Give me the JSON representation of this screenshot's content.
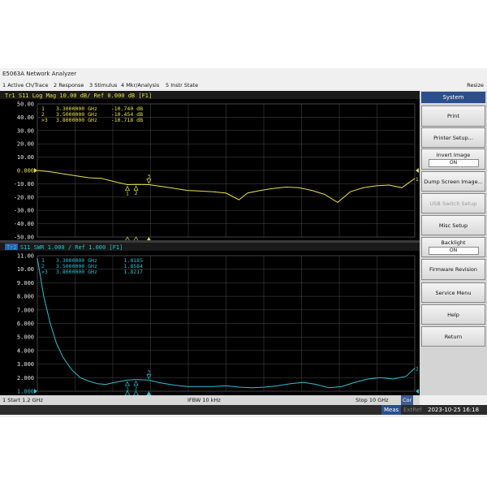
{
  "window": {
    "title": "E5063A Network Analyzer",
    "menu": [
      "1 Active Ch/Trace",
      "2 Response",
      "3 Stimulus",
      "4 Mkr/Analysis",
      "5 Instr State"
    ],
    "resize_label": "Resize"
  },
  "trace1": {
    "header": "Tr1  S11  Log Mag 10.00 dB/ Ref 0.000 dB  [F1]",
    "color": "#e8e23a",
    "markers": [
      {
        "label": "1",
        "freq": "3.3000000 GHz",
        "value": "-10.740 dB"
      },
      {
        "label": "2",
        "freq": "3.5000000 GHz",
        "value": "-10.454 dB"
      },
      {
        "label": ">3",
        "freq": "3.8000000 GHz",
        "value": "-10.718 dB"
      }
    ],
    "yticks": [
      "50.00",
      "40.00",
      "30.00",
      "20.00",
      "10.00",
      "0.000",
      "-10.00",
      "-20.00",
      "-30.00",
      "-40.00",
      "-50.00"
    ],
    "trace_end_label": "1"
  },
  "trace2": {
    "header": "Tr2  S11  SWR 1.000 / Ref 1.000  [F1]",
    "color": "#25c4cf",
    "markers": [
      {
        "label": "1",
        "freq": "3.3000000 GHz",
        "value": "1.8185"
      },
      {
        "label": "2",
        "freq": "3.5000000 GHz",
        "value": "1.8584"
      },
      {
        "label": ">3",
        "freq": "3.8000000 GHz",
        "value": "1.8217"
      }
    ],
    "yticks": [
      "11.00",
      "10.00",
      "9.000",
      "8.000",
      "7.000",
      "6.000",
      "5.000",
      "4.000",
      "3.000",
      "2.000",
      "1.000"
    ],
    "trace_end_label": "2"
  },
  "chart_data": [
    {
      "type": "line",
      "title": "Tr1  S11  Log Mag 10.00 dB/ Ref 0.000 dB  [F1]",
      "x_unit": "GHz",
      "xlim": [
        1.2,
        10
      ],
      "ylim": [
        -50,
        50
      ],
      "grid": true,
      "series": [
        {
          "x": [
            1.2,
            1.5,
            1.8,
            2.1,
            2.4,
            2.7,
            3.0,
            3.3,
            3.5,
            3.8,
            4.1,
            4.4,
            4.7,
            5.0,
            5.3,
            5.6,
            5.9,
            6.1,
            6.4,
            6.7,
            7.0,
            7.3,
            7.6,
            7.9,
            8.2,
            8.5,
            8.8,
            9.1,
            9.4,
            9.7,
            10.0
          ],
          "y": [
            0.0,
            -1.0,
            -2.5,
            -4.0,
            -5.5,
            -6.0,
            -8.5,
            -10.7,
            -10.5,
            -10.7,
            -12.0,
            -13.5,
            -15.0,
            -15.5,
            -16.0,
            -17.0,
            -22.0,
            -17.0,
            -15.0,
            -13.5,
            -12.5,
            -13.0,
            -15.0,
            -18.0,
            -24.0,
            -16.0,
            -13.0,
            -11.5,
            -11.0,
            -13.0,
            -6.0
          ]
        }
      ]
    },
    {
      "type": "line",
      "title": "Tr2  S11  SWR 1.000 / Ref 1.000  [F1]",
      "x_unit": "GHz",
      "xlim": [
        1.2,
        10
      ],
      "ylim": [
        1,
        11
      ],
      "grid": true,
      "series": [
        {
          "x": [
            1.2,
            1.35,
            1.5,
            1.65,
            1.8,
            2.0,
            2.2,
            2.4,
            2.6,
            2.8,
            3.0,
            3.3,
            3.5,
            3.8,
            4.1,
            4.4,
            4.7,
            5.0,
            5.3,
            5.6,
            5.9,
            6.2,
            6.5,
            6.8,
            7.1,
            7.4,
            7.7,
            8.0,
            8.3,
            8.6,
            8.9,
            9.2,
            9.5,
            9.8,
            10.0
          ],
          "y": [
            10.8,
            8.0,
            6.0,
            4.5,
            3.5,
            2.6,
            2.0,
            1.75,
            1.55,
            1.5,
            1.65,
            1.82,
            1.86,
            1.82,
            1.6,
            1.45,
            1.35,
            1.35,
            1.35,
            1.4,
            1.3,
            1.25,
            1.3,
            1.4,
            1.55,
            1.65,
            1.5,
            1.25,
            1.35,
            1.65,
            1.9,
            2.0,
            1.9,
            2.1,
            2.7
          ]
        }
      ]
    }
  ],
  "status": {
    "start": "1  Start 1.2 GHz",
    "ifbw": "IFBW 10 kHz",
    "stop": "Stop 10 GHz",
    "cor": "Cor",
    "meas": "Meas",
    "extref": "ExtRef",
    "datetime": "2023-10-25 16:18"
  },
  "softkeys": {
    "header": "System",
    "items": [
      {
        "label": "Print"
      },
      {
        "label": "Printer Setup..."
      },
      {
        "label": "Invert Image",
        "value": "ON"
      },
      {
        "label": "Dump Screen Image..."
      },
      {
        "label": "USB Switch Setup",
        "disabled": true
      },
      {
        "label": "Misc Setup"
      },
      {
        "label": "Backlight",
        "value": "ON"
      },
      {
        "label": "Firmware Revision"
      },
      {
        "label": "Service Menu"
      },
      {
        "label": "Help"
      },
      {
        "label": "Return"
      }
    ]
  }
}
